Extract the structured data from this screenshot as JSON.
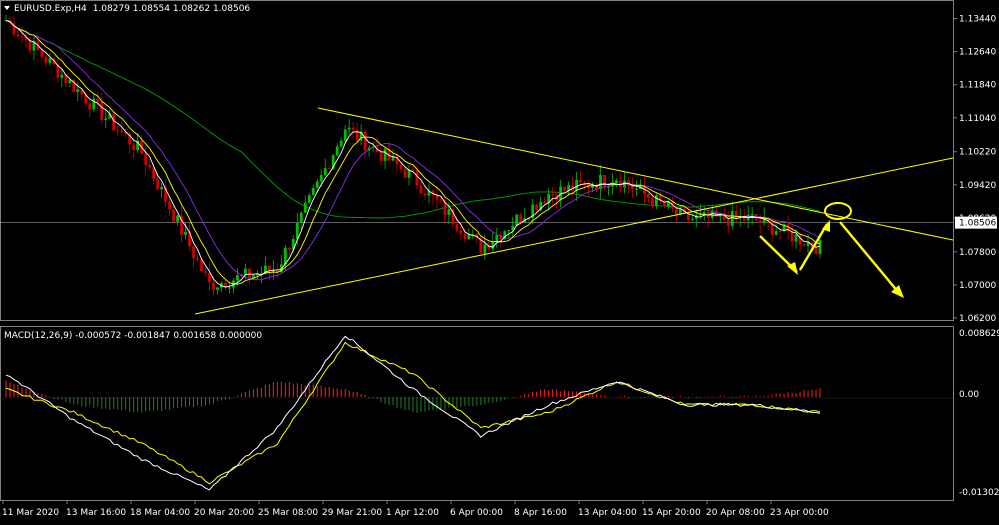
{
  "window": {
    "symbol": "EURUSD.Exp,H4",
    "ohlc": "1.08279 1.08554 1.08262 1.08506",
    "menu_icon": "triangle-down-icon"
  },
  "price_axis": {
    "ticks": [
      "1.13440",
      "1.12640",
      "1.11840",
      "1.11040",
      "1.10220",
      "1.09420",
      "1.08620",
      "1.07800",
      "1.07000",
      "1.06200"
    ],
    "current_price_label": "1.08506"
  },
  "macd_axis": {
    "ticks": [
      "0.008629",
      "0.00",
      "-0.013023"
    ]
  },
  "time_axis": {
    "labels": [
      "11 Mar 2020",
      "13 Mar 16:00",
      "18 Mar 04:00",
      "20 Mar 20:00",
      "25 Mar 08:00",
      "29 Mar 21:00",
      "1 Apr 12:00",
      "6 Apr 00:00",
      "8 Apr 16:00",
      "13 Apr 04:00",
      "15 Apr 20:00",
      "20 Apr 08:00",
      "23 Apr 00:00"
    ]
  },
  "macd_panel": {
    "title": "MACD(12,26,9) -0.000572 -0.001847 0.001658 0.000000"
  },
  "colors": {
    "background": "#000000",
    "bull_candle": "#00c000",
    "bear_candle": "#d00000",
    "ma_fast": "#ffffff",
    "ma_mid": "#ffff00",
    "ma_slow": "#8a2be2",
    "ma_long": "#00a000",
    "trendline": "#ffff00",
    "macd_line": "#ffffff",
    "signal_line": "#ffff00",
    "hist_pos": "#ff2020",
    "hist_neg": "#208020",
    "arrow": "#ffff00"
  },
  "chart_data": {
    "type": "line",
    "symbol": "EURUSD",
    "timeframe": "H4",
    "price_range": [
      1.062,
      1.1384
    ],
    "x": [
      "11 Mar 2020",
      "13 Mar 16:00",
      "18 Mar 04:00",
      "20 Mar 20:00",
      "25 Mar 08:00",
      "29 Mar 21:00",
      "1 Apr 12:00",
      "6 Apr 00:00",
      "8 Apr 16:00",
      "13 Apr 04:00",
      "15 Apr 20:00",
      "20 Apr 08:00",
      "23 Apr 00:00"
    ],
    "series": [
      {
        "values": [
          1.134,
          1.118,
          1.102,
          1.07,
          1.074,
          1.108,
          1.096,
          1.079,
          1.092,
          1.096,
          1.086,
          1.086,
          1.079
        ]
      }
    ],
    "current_price": 1.08506,
    "macd": {
      "params": "12,26,9",
      "range": [
        -0.013023,
        0.008629
      ],
      "values": [
        -0.000572,
        -0.001847,
        0.001658,
        0.0
      ],
      "macd_line": [
        0.003,
        -0.003,
        -0.008,
        -0.012,
        -0.004,
        0.008,
        0.001,
        -0.005,
        -0.001,
        0.002,
        -0.001,
        -0.001,
        -0.002
      ],
      "signal_line": [
        0.001,
        -0.002,
        -0.006,
        -0.011,
        -0.006,
        0.007,
        0.003,
        -0.004,
        -0.002,
        0.002,
        -0.001,
        -0.001,
        -0.002
      ],
      "histogram": [
        0.002,
        -0.001,
        -0.002,
        -0.001,
        0.002,
        0.001,
        -0.002,
        -0.001,
        0.001,
        0.0,
        0.0,
        0.0,
        0.001
      ]
    }
  }
}
